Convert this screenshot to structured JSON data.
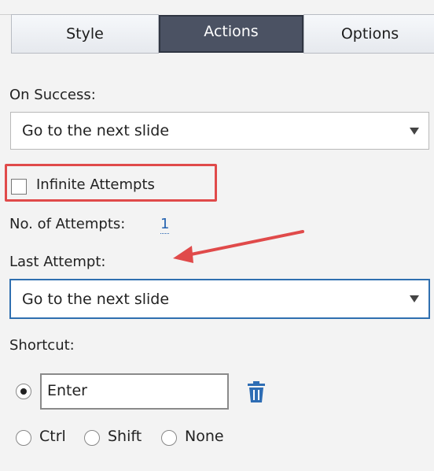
{
  "tabs": {
    "style": "Style",
    "actions": "Actions",
    "options": "Options"
  },
  "on_success": {
    "label": "On Success:",
    "value": "Go to the next slide"
  },
  "infinite_attempts": {
    "label": "Infinite Attempts",
    "checked": false
  },
  "attempts": {
    "label": "No. of Attempts:",
    "value": "1"
  },
  "last_attempt": {
    "label": "Last Attempt:",
    "value": "Go to the next slide"
  },
  "shortcut": {
    "label": "Shortcut:",
    "value": "Enter",
    "options": {
      "ctrl": "Ctrl",
      "shift": "Shift",
      "none": "None"
    }
  },
  "colors": {
    "accent": "#2563b0",
    "active_tab": "#4b5263",
    "highlight": "#e04a4a"
  },
  "icons": {
    "delete": "trash-icon",
    "annotation": "arrow-annotation"
  }
}
